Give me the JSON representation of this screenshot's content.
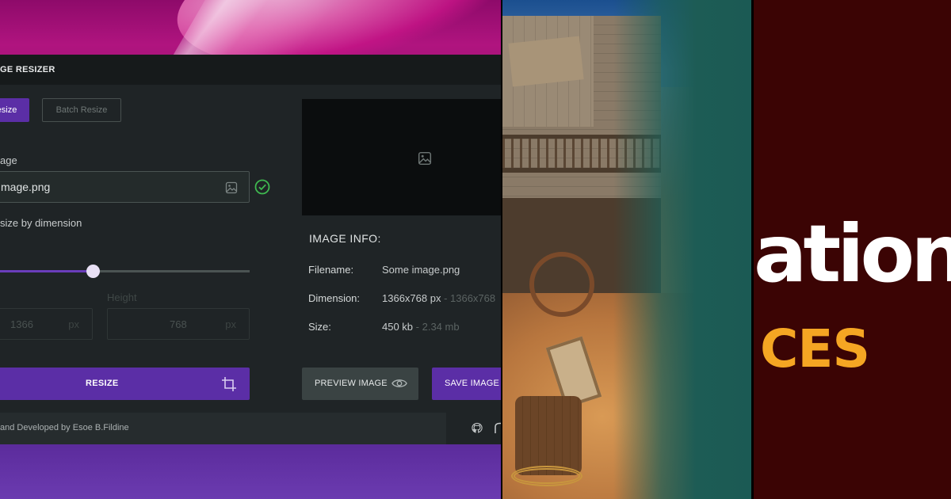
{
  "app": {
    "title": "GE RESIZER",
    "tabs": {
      "resize": "esize",
      "batch": "Batch Resize"
    },
    "image_field": {
      "label": "age",
      "value": "mage.png"
    },
    "resize_mode_label": "size by dimension",
    "slider": {
      "level_fraction": 0.39
    },
    "dimensions": {
      "width_value": "1366",
      "width_unit": "px",
      "height_label": "Height",
      "height_value": "768",
      "height_unit": "px"
    },
    "resize_button": "RESIZE",
    "info": {
      "title": "IMAGE INFO:",
      "filename_key": "Filename:",
      "filename_val": "Some image.png",
      "dimension_key": "Dimension:",
      "dimension_val": "1366x768 px",
      "dimension_sub": " - 1366x768",
      "size_key": "Size:",
      "size_val": "450 kb",
      "size_sub": " - 2.34 mb"
    },
    "preview_button": "PREVIEW IMAGE",
    "save_button": "SAVE IMAGE",
    "footer_text": "and Developed by Esoe B.Fildine",
    "colors": {
      "accent": "#5b2ea6",
      "check": "#3fb950"
    }
  },
  "maroon_panel": {
    "big_word": "ation",
    "orange_word": "CES",
    "colors": {
      "background": "#3b0404",
      "orange": "#f5a623"
    }
  }
}
